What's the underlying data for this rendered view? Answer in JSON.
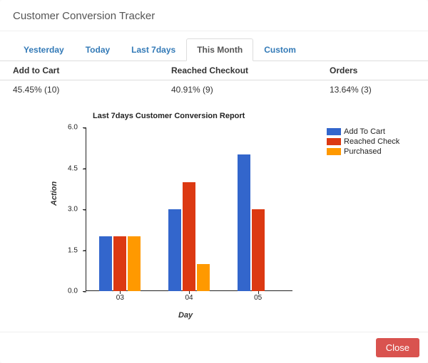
{
  "title": "Customer Conversion Tracker",
  "tabs": [
    {
      "label": "Yesterday",
      "active": false
    },
    {
      "label": "Today",
      "active": false
    },
    {
      "label": "Last 7days",
      "active": false
    },
    {
      "label": "This Month",
      "active": true
    },
    {
      "label": "Custom",
      "active": false
    }
  ],
  "metrics_header": {
    "col0": "Add to Cart",
    "col1": "Reached Checkout",
    "col2": "Orders"
  },
  "metrics_row": {
    "col0": "45.45% (10)",
    "col1": "40.91% (9)",
    "col2": "13.64% (3)"
  },
  "footer": {
    "close": "Close"
  },
  "colors": {
    "series0": "#3366cc",
    "series1": "#dc3912",
    "series2": "#ff9900"
  },
  "chart_data": {
    "type": "bar",
    "title": "Last 7days Customer Conversion Report",
    "xlabel": "Day",
    "ylabel": "Action",
    "categories": [
      "03",
      "04",
      "05"
    ],
    "series": [
      {
        "name": "Add To Cart",
        "values": [
          2,
          3,
          5
        ]
      },
      {
        "name": "Reached Checkout",
        "values": [
          2,
          4,
          3
        ]
      },
      {
        "name": "Purchased",
        "values": [
          2,
          1,
          0
        ]
      }
    ],
    "legend_labels": [
      "Add To Cart",
      "Reached Check",
      "Purchased"
    ],
    "ylim": [
      0.0,
      6.0
    ],
    "yticks": [
      0.0,
      1.5,
      3.0,
      4.5,
      6.0
    ]
  }
}
